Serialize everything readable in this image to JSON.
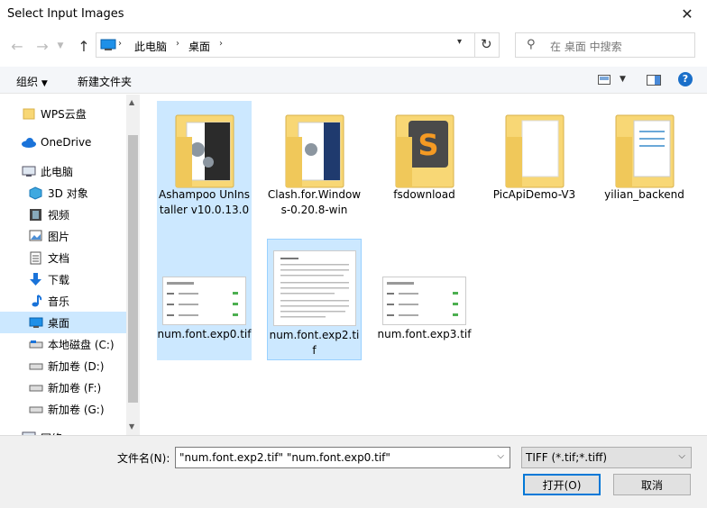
{
  "window": {
    "title": "Select Input Images"
  },
  "nav": {
    "breadcrumb": [
      "此电脑",
      "桌面"
    ],
    "search_placeholder": "在 桌面 中搜索"
  },
  "toolbar": {
    "organize": "组织",
    "new_folder": "新建文件夹"
  },
  "sidebar": {
    "items": [
      {
        "label": "WPS云盘"
      },
      {
        "label": "OneDrive"
      },
      {
        "label": "此电脑"
      },
      {
        "label": "3D 对象"
      },
      {
        "label": "视频"
      },
      {
        "label": "图片"
      },
      {
        "label": "文档"
      },
      {
        "label": "下载"
      },
      {
        "label": "音乐"
      },
      {
        "label": "桌面"
      },
      {
        "label": "本地磁盘 (C:)"
      },
      {
        "label": "新加卷 (D:)"
      },
      {
        "label": "新加卷 (F:)"
      },
      {
        "label": "新加卷 (G:)"
      },
      {
        "label": "网络"
      }
    ]
  },
  "files": [
    {
      "name": "Ashampoo UnInstaller v10.0.13.0"
    },
    {
      "name": "Clash.for.Windows-0.20.8-win"
    },
    {
      "name": "fsdownload"
    },
    {
      "name": "PicApiDemo-V3"
    },
    {
      "name": "yilian_backend"
    },
    {
      "name": "num.font.exp0.tif"
    },
    {
      "name": "num.font.exp2.tif"
    },
    {
      "name": "num.font.exp3.tif"
    }
  ],
  "footer": {
    "filename_label": "文件名(N):",
    "filename_value": "\"num.font.exp2.tif\" \"num.font.exp0.tif\"",
    "filetype_value": "TIFF (*.tif;*.tiff)",
    "open_label": "打开(O)",
    "cancel_label": "取消"
  },
  "colors": {
    "selection": "#cce8ff",
    "accent": "#0078d7",
    "folder": "#f8d775"
  }
}
